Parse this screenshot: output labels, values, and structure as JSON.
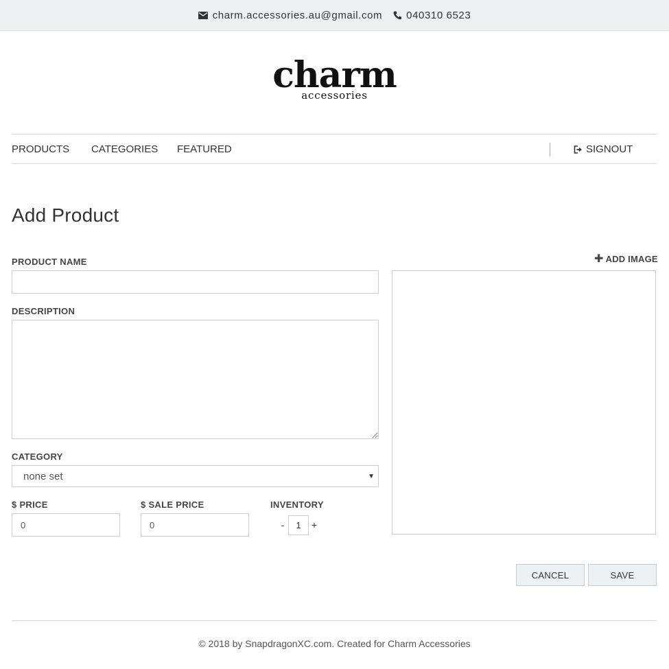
{
  "topbar": {
    "email": "charm.accessories.au@gmail.com",
    "phone": "040310 6523",
    "email_icon": "envelope-icon",
    "phone_icon": "phone-icon"
  },
  "logo": {
    "word": "charm",
    "sub": "accessories"
  },
  "nav": {
    "items": [
      {
        "label": "PRODUCTS"
      },
      {
        "label": "CATEGORIES"
      },
      {
        "label": "FEATURED"
      }
    ],
    "signout_label": "SIGNOUT",
    "signout_icon": "sign-out-icon"
  },
  "page": {
    "title": "Add Product"
  },
  "form": {
    "product_name_label": "PRODUCT NAME",
    "product_name_value": "",
    "description_label": "DESCRIPTION",
    "description_value": "",
    "category_label": "CATEGORY",
    "category_selected": "none set",
    "price_label": "$ PRICE",
    "price_value": "0",
    "sale_price_label": "$ SALE PRICE",
    "sale_price_value": "0",
    "inventory_label": "INVENTORY",
    "inventory_minus": "-",
    "inventory_value": "1",
    "inventory_plus": "+",
    "add_image_label": "ADD IMAGE",
    "add_image_icon": "plus-icon"
  },
  "actions": {
    "cancel_label": "CANCEL",
    "save_label": "SAVE"
  },
  "footer": {
    "text": "© 2018 by SnapdragonXC.com. Created for Charm Accessories"
  },
  "colors": {
    "topbar_bg": "#edf0f3",
    "button_bg": "#edf0f3",
    "border": "#cccccc",
    "text": "#333333"
  }
}
